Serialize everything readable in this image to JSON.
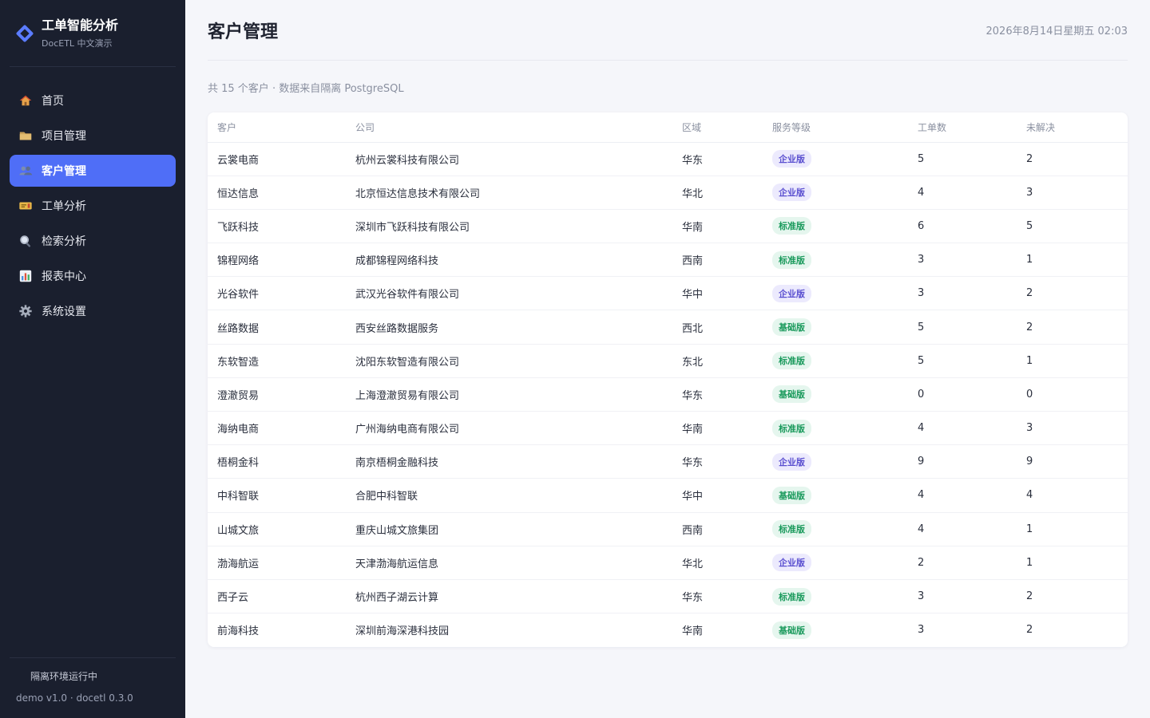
{
  "brand": {
    "title": "工单智能分析",
    "subtitle": "DocETL 中文演示"
  },
  "nav": [
    {
      "label": "首页",
      "icon": "house-icon",
      "active": false
    },
    {
      "label": "项目管理",
      "icon": "folder-icon",
      "active": false
    },
    {
      "label": "客户管理",
      "icon": "users-icon",
      "active": true
    },
    {
      "label": "工单分析",
      "icon": "ticket-icon",
      "active": false
    },
    {
      "label": "检索分析",
      "icon": "magnifier-icon",
      "active": false
    },
    {
      "label": "报表中心",
      "icon": "bar-chart-icon",
      "active": false
    },
    {
      "label": "系统设置",
      "icon": "gear-icon",
      "active": false
    }
  ],
  "footer": {
    "status": "隔离环境运行中",
    "version": "demo v1.0 · docetl 0.3.0"
  },
  "header": {
    "title": "客户管理",
    "datetime": "2026年8月14日星期五 02:03"
  },
  "summary": "共 15 个客户 · 数据来自隔离 PostgreSQL",
  "table": {
    "columns": [
      "客户",
      "公司",
      "区域",
      "服务等级",
      "工单数",
      "未解决"
    ],
    "rows": [
      [
        "云裳电商",
        "杭州云裳科技有限公司",
        "华东",
        "企业版",
        "5",
        "2"
      ],
      [
        "恒达信息",
        "北京恒达信息技术有限公司",
        "华北",
        "企业版",
        "4",
        "3"
      ],
      [
        "飞跃科技",
        "深圳市飞跃科技有限公司",
        "华南",
        "标准版",
        "6",
        "5"
      ],
      [
        "锦程网络",
        "成都锦程网络科技",
        "西南",
        "标准版",
        "3",
        "1"
      ],
      [
        "光谷软件",
        "武汉光谷软件有限公司",
        "华中",
        "企业版",
        "3",
        "2"
      ],
      [
        "丝路数据",
        "西安丝路数据服务",
        "西北",
        "基础版",
        "5",
        "2"
      ],
      [
        "东软智造",
        "沈阳东软智造有限公司",
        "东北",
        "标准版",
        "5",
        "1"
      ],
      [
        "澄澈贸易",
        "上海澄澈贸易有限公司",
        "华东",
        "基础版",
        "0",
        "0"
      ],
      [
        "海纳电商",
        "广州海纳电商有限公司",
        "华南",
        "标准版",
        "4",
        "3"
      ],
      [
        "梧桐金科",
        "南京梧桐金融科技",
        "华东",
        "企业版",
        "9",
        "9"
      ],
      [
        "中科智联",
        "合肥中科智联",
        "华中",
        "基础版",
        "4",
        "4"
      ],
      [
        "山城文旅",
        "重庆山城文旅集团",
        "西南",
        "标准版",
        "4",
        "1"
      ],
      [
        "渤海航运",
        "天津渤海航运信息",
        "华北",
        "企业版",
        "2",
        "1"
      ],
      [
        "西子云",
        "杭州西子湖云计算",
        "华东",
        "标准版",
        "3",
        "2"
      ],
      [
        "前海科技",
        "深圳前海深港科技园",
        "华南",
        "基础版",
        "3",
        "2"
      ]
    ]
  },
  "colors": {
    "sidebar_bg": "#1a1f2e",
    "accent": "#4f6ef7",
    "enterprise": "#5a4fd0",
    "standard": "#1a9a5c"
  }
}
